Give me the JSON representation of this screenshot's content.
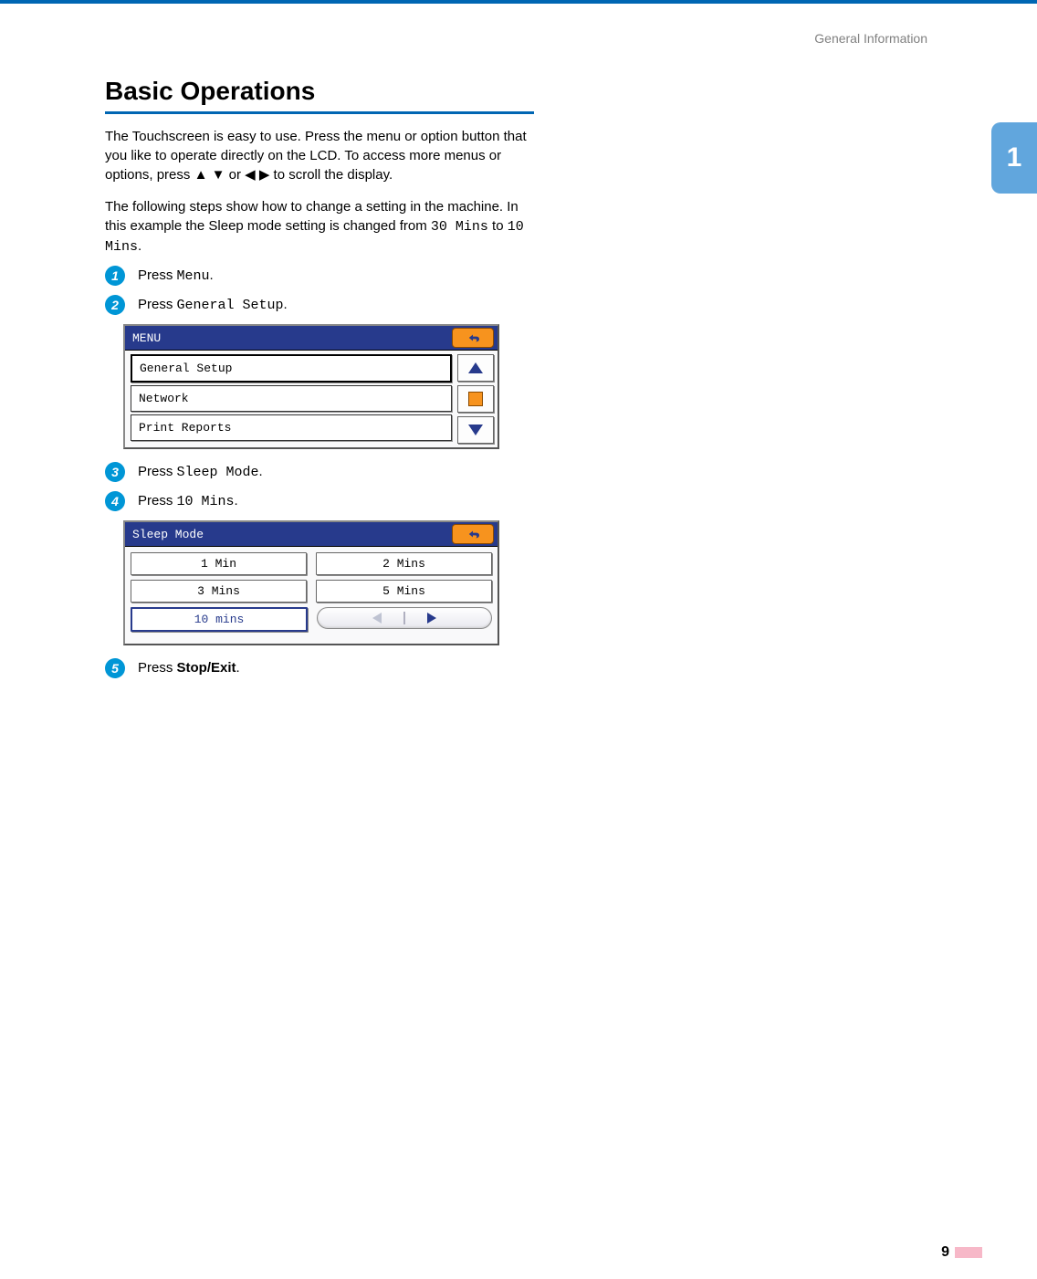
{
  "header": {
    "section": "General Information"
  },
  "sidebar": {
    "chapter": "1"
  },
  "title": "Basic Operations",
  "intro1_a": "The Touchscreen is easy to use. Press the menu or option button that you like to operate directly on the LCD. To access more menus or options, press ",
  "intro1_arrows1": "▲ ▼",
  "intro1_or": " or ",
  "intro1_arrows2": "◀ ▶",
  "intro1_b": " to scroll the display.",
  "intro2_a": "The following steps show how to change a setting in the machine. In this example the Sleep mode setting is changed from ",
  "intro2_from": "30 Mins",
  "intro2_to_word": " to ",
  "intro2_to": "10 Mins",
  "intro2_end": ".",
  "steps": {
    "s1": {
      "num": "1",
      "pre": "Press ",
      "cmd": "Menu",
      "post": "."
    },
    "s2": {
      "num": "2",
      "pre": "Press ",
      "cmd": "General Setup",
      "post": "."
    },
    "s3": {
      "num": "3",
      "pre": "Press ",
      "cmd": "Sleep Mode",
      "post": "."
    },
    "s4": {
      "num": "4",
      "pre": "Press ",
      "cmd": "10 Mins",
      "post": "."
    },
    "s5": {
      "num": "5",
      "pre": "Press ",
      "bold": "Stop/Exit",
      "post": "."
    }
  },
  "lcd_menu": {
    "title": "MENU",
    "items": [
      "General Setup",
      "Network",
      "Print Reports"
    ]
  },
  "lcd_sleep": {
    "title": "Sleep Mode",
    "options": [
      "1 Min",
      "2 Mins",
      "3 Mins",
      "5 Mins",
      "10 mins"
    ]
  },
  "footer": {
    "page": "9"
  }
}
